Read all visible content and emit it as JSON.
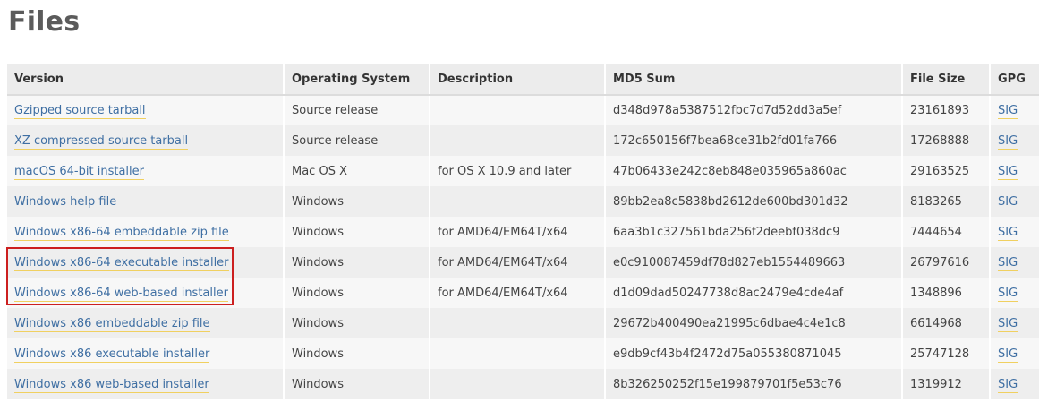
{
  "page": {
    "title": "Files"
  },
  "table": {
    "headers": [
      "Version",
      "Operating System",
      "Description",
      "MD5 Sum",
      "File Size",
      "GPG"
    ],
    "rows": [
      {
        "version": "Gzipped source tarball",
        "os": "Source release",
        "description": "",
        "md5": "d348d978a5387512fbc7d7d52dd3a5ef",
        "size": "23161893",
        "gpg": "SIG"
      },
      {
        "version": "XZ compressed source tarball",
        "os": "Source release",
        "description": "",
        "md5": "172c650156f7bea68ce31b2fd01fa766",
        "size": "17268888",
        "gpg": "SIG"
      },
      {
        "version": "macOS 64-bit installer",
        "os": "Mac OS X",
        "description": "for OS X 10.9 and later",
        "md5": "47b06433e242c8eb848e035965a860ac",
        "size": "29163525",
        "gpg": "SIG"
      },
      {
        "version": "Windows help file",
        "os": "Windows",
        "description": "",
        "md5": "89bb2ea8c5838bd2612de600bd301d32",
        "size": "8183265",
        "gpg": "SIG"
      },
      {
        "version": "Windows x86-64 embeddable zip file",
        "os": "Windows",
        "description": "for AMD64/EM64T/x64",
        "md5": "6aa3b1c327561bda256f2deebf038dc9",
        "size": "7444654",
        "gpg": "SIG"
      },
      {
        "version": "Windows x86-64 executable installer",
        "os": "Windows",
        "description": "for AMD64/EM64T/x64",
        "md5": "e0c910087459df78d827eb1554489663",
        "size": "26797616",
        "gpg": "SIG"
      },
      {
        "version": "Windows x86-64 web-based installer",
        "os": "Windows",
        "description": "for AMD64/EM64T/x64",
        "md5": "d1d09dad50247738d8ac2479e4cde4af",
        "size": "1348896",
        "gpg": "SIG"
      },
      {
        "version": "Windows x86 embeddable zip file",
        "os": "Windows",
        "description": "",
        "md5": "29672b400490ea21995c6dbae4c4e1c8",
        "size": "6614968",
        "gpg": "SIG"
      },
      {
        "version": "Windows x86 executable installer",
        "os": "Windows",
        "description": "",
        "md5": "e9db9cf43b4f2472d75a055380871045",
        "size": "25747128",
        "gpg": "SIG"
      },
      {
        "version": "Windows x86 web-based installer",
        "os": "Windows",
        "description": "",
        "md5": "8b326250252f15e199879701f5e53c76",
        "size": "1319912",
        "gpg": "SIG"
      }
    ]
  },
  "colors": {
    "link": "#3f6fa3",
    "link_underline": "#f0d060",
    "highlight_border": "#cc1f1f",
    "header_bg": "#ececec",
    "row_odd_bg": "#f7f7f7",
    "row_even_bg": "#eeeeee"
  }
}
